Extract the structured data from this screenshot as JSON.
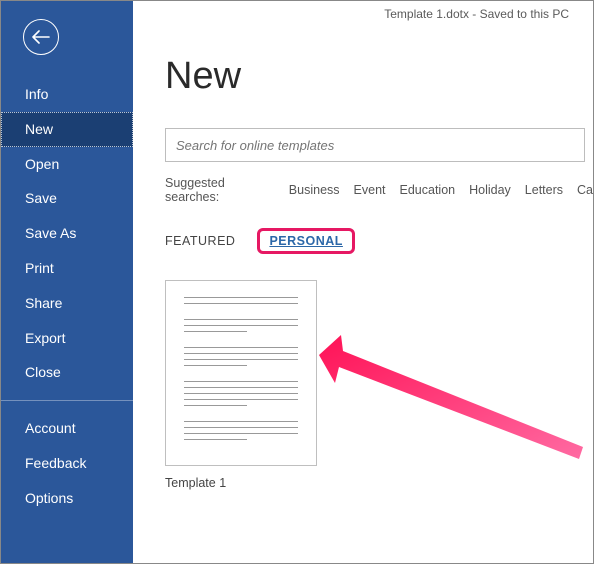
{
  "titlebar": "Template 1.dotx - Saved to this PC",
  "sidebar": {
    "items": [
      {
        "label": "Info",
        "active": false
      },
      {
        "label": "New",
        "active": true
      },
      {
        "label": "Open",
        "active": false
      },
      {
        "label": "Save",
        "active": false
      },
      {
        "label": "Save As",
        "active": false
      },
      {
        "label": "Print",
        "active": false
      },
      {
        "label": "Share",
        "active": false
      },
      {
        "label": "Export",
        "active": false
      },
      {
        "label": "Close",
        "active": false
      }
    ],
    "footer_items": [
      {
        "label": "Account"
      },
      {
        "label": "Feedback"
      },
      {
        "label": "Options"
      }
    ]
  },
  "page": {
    "title": "New",
    "search_placeholder": "Search for online templates",
    "suggested_label": "Suggested searches:",
    "suggested": [
      "Business",
      "Event",
      "Education",
      "Holiday",
      "Letters",
      "Ca"
    ],
    "tabs": {
      "featured": "FEATURED",
      "personal": "PERSONAL"
    },
    "templates": [
      {
        "caption": "Template 1"
      }
    ]
  },
  "colors": {
    "brand": "#2b579a",
    "highlight": "#e61863"
  }
}
